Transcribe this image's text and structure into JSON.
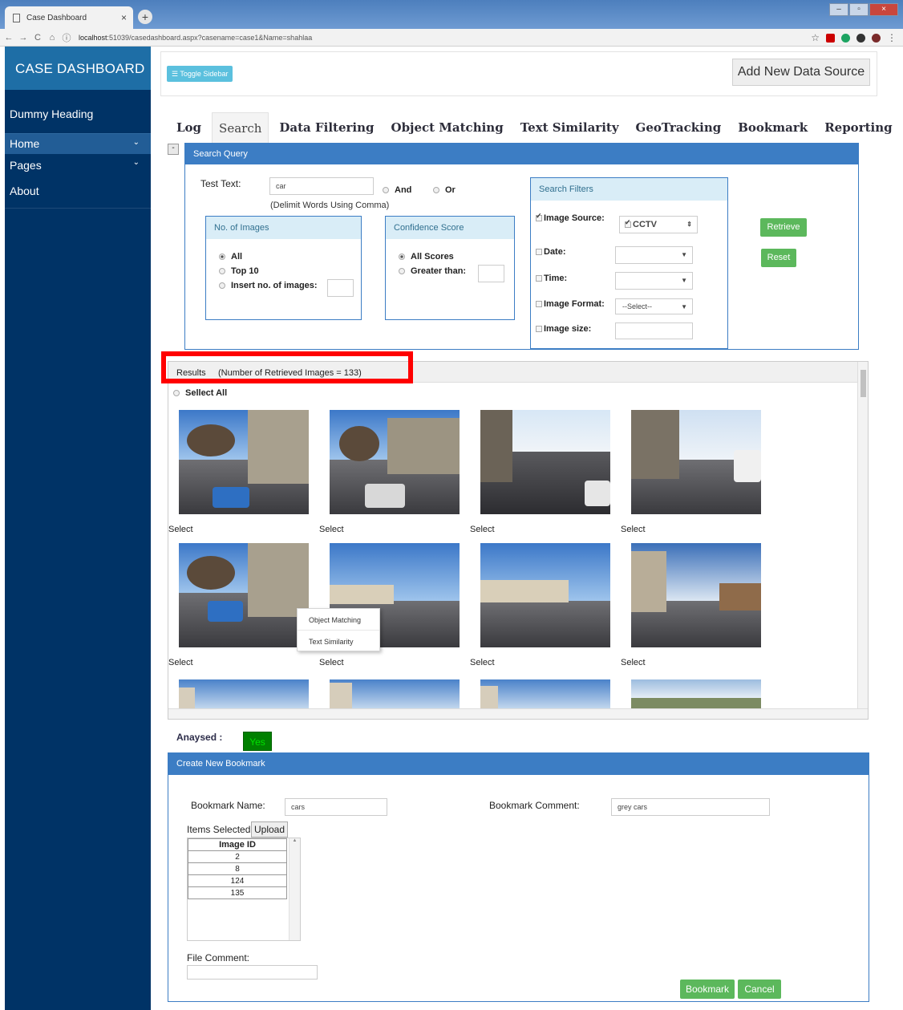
{
  "browser": {
    "tab_title": "Case Dashboard",
    "tab_close": "×",
    "new_tab": "+",
    "url_host": "localhost",
    "url_rest": ":51039/casedashboard.aspx?casename=case1&Name=shahlaa",
    "back": "←",
    "forward": "→",
    "reload": "C",
    "home": "⌂",
    "info": "ⓘ",
    "star": "☆",
    "menu": "⋮",
    "icon_colors": [
      "#cc0000",
      "#1da462",
      "#333333",
      "#7a2a2a"
    ]
  },
  "sidebar": {
    "brand": "CASE DASHBOARD",
    "heading": "Dummy Heading",
    "items": [
      {
        "label": "Home",
        "icon": "chevron-down-icon"
      },
      {
        "label": "Pages",
        "icon": "chevron-down-icon"
      },
      {
        "label": "About"
      }
    ],
    "bg_color": "#003366",
    "brand_color": "#1e6ea6"
  },
  "topbar": {
    "toggle_label": "Toggle Sidebar",
    "add_source_label": "Add New Data Source"
  },
  "tabs": [
    "Log",
    "Search",
    "Data Filtering",
    "Object Matching",
    "Text Similarity",
    "GeoTracking",
    "Bookmark",
    "Reporting"
  ],
  "active_tab": "Search",
  "search_query": {
    "collapse_symbol": "-",
    "title": "Search Query",
    "test_text_label": "Test Text:",
    "test_text_value": "car",
    "hint": "(Delimit Words Using Comma)",
    "and_label": "And",
    "or_label": "Or",
    "num_images": {
      "title": "No. of Images",
      "options": [
        "All",
        "Top 10",
        "Insert no. of images:"
      ],
      "selected": "All"
    },
    "confidence": {
      "title": "Confidence Score",
      "options": [
        "All Scores",
        "Greater than:"
      ],
      "selected": "All Scores"
    },
    "filters": {
      "title": "Search Filters",
      "image_source_label": "Image Source:",
      "image_source_value": "CCTV",
      "date_label": "Date:",
      "time_label": "Time:",
      "format_label": "Image Format:",
      "format_value": "--Select--",
      "size_label": "Image size:"
    },
    "retrieve_label": "Retrieve",
    "reset_label": "Reset",
    "accent_color": "#3c7dc4"
  },
  "results": {
    "label": "Results",
    "count_text": "(Number of Retrieved Images = 133)",
    "select_all": "Sellect All",
    "select_label": "Select",
    "image_count": 133
  },
  "context_menu": [
    "Object Matching",
    "Text Similarity"
  ],
  "analysed": {
    "label": "Anaysed :",
    "value": "Yes"
  },
  "bookmark": {
    "title": "Create New Bookmark",
    "name_label": "Bookmark Name:",
    "name_value": "cars",
    "comment_label": "Bookmark Comment:",
    "comment_value": "grey cars",
    "items_selected_label": "Items Selected",
    "upload_label": "Upload",
    "table_header": "Image ID",
    "image_ids": [
      "2",
      "8",
      "124",
      "135"
    ],
    "file_comment_label": "File Comment:",
    "bookmark_btn": "Bookmark",
    "cancel_btn": "Cancel"
  }
}
